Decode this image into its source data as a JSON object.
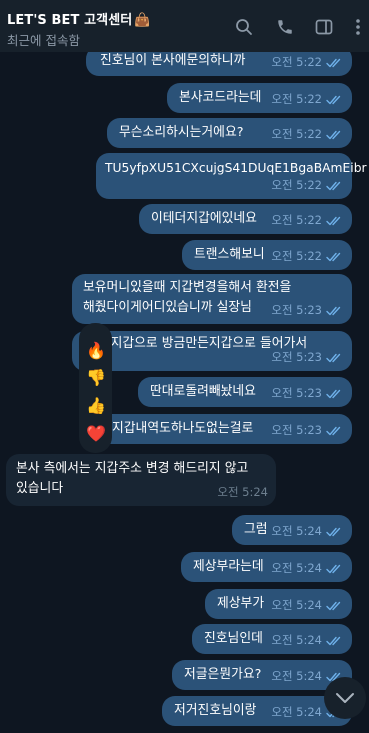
{
  "header": {
    "title": "LET'S BET 고객센터",
    "title_emoji": "👜",
    "status": "최근에 접속함"
  },
  "messages": [
    {
      "text": "진호님이 본사에문의하니까",
      "time": "오전 5:22"
    },
    {
      "text": "본사코드라는데",
      "time": "오전 5:22"
    },
    {
      "text": "무슨소리하시는거에요?",
      "time": "오전 5:22"
    },
    {
      "text": "TU5yfpXU51CXcujgS41DUqE1BgaBAmEibr",
      "time": "오전 5:22"
    },
    {
      "text": "이테더지갑에있네요",
      "time": "오전 5:22"
    },
    {
      "text": "트랜스해보니",
      "time": "오전 5:22"
    },
    {
      "text_line1": "보유머니있을때 지갑변경을해서 환전을",
      "text_line2": "해줬다이게어디있습니까 실장님",
      "time": "오전 5:23"
    },
    {
      "text": "도 새지갑으로 방금만든지갑으로 들어가서",
      "time": "오전 5:23"
    },
    {
      "text": "딴대로돌려빼놨네요",
      "time": "오전 5:23"
    },
    {
      "text": "지갑내역도하나도없는걸로",
      "time": "오전 5:23"
    },
    {
      "text_line1": "본사 측에서는 지갑주소 변경 해드리지 않고",
      "text_line2": "있습니다",
      "time": "오전 5:24"
    },
    {
      "text": "그럼",
      "time": "오전 5:24"
    },
    {
      "text": "제상부라는데",
      "time": "오전 5:24"
    },
    {
      "text": "제상부가",
      "time": "오전 5:24"
    },
    {
      "text": "진호님인데",
      "time": "오전 5:24"
    },
    {
      "text": "저글은뭔가요?",
      "time": "오전 5:24"
    },
    {
      "text": "저거진호님이랑",
      "time": "오전 5:24"
    }
  ],
  "reactions": [
    "🔥",
    "👎",
    "👍",
    "❤️"
  ],
  "colors": {
    "background": "#0e1621",
    "header": "#17212b",
    "outgoing_bubble": "#2b5278",
    "incoming_bubble": "#182533",
    "read_check": "#6fb1ea"
  },
  "icons": [
    "search-icon",
    "phone-icon",
    "sidebar-toggle-icon",
    "more-vertical-icon",
    "double-check-icon",
    "chevron-down-icon"
  ]
}
